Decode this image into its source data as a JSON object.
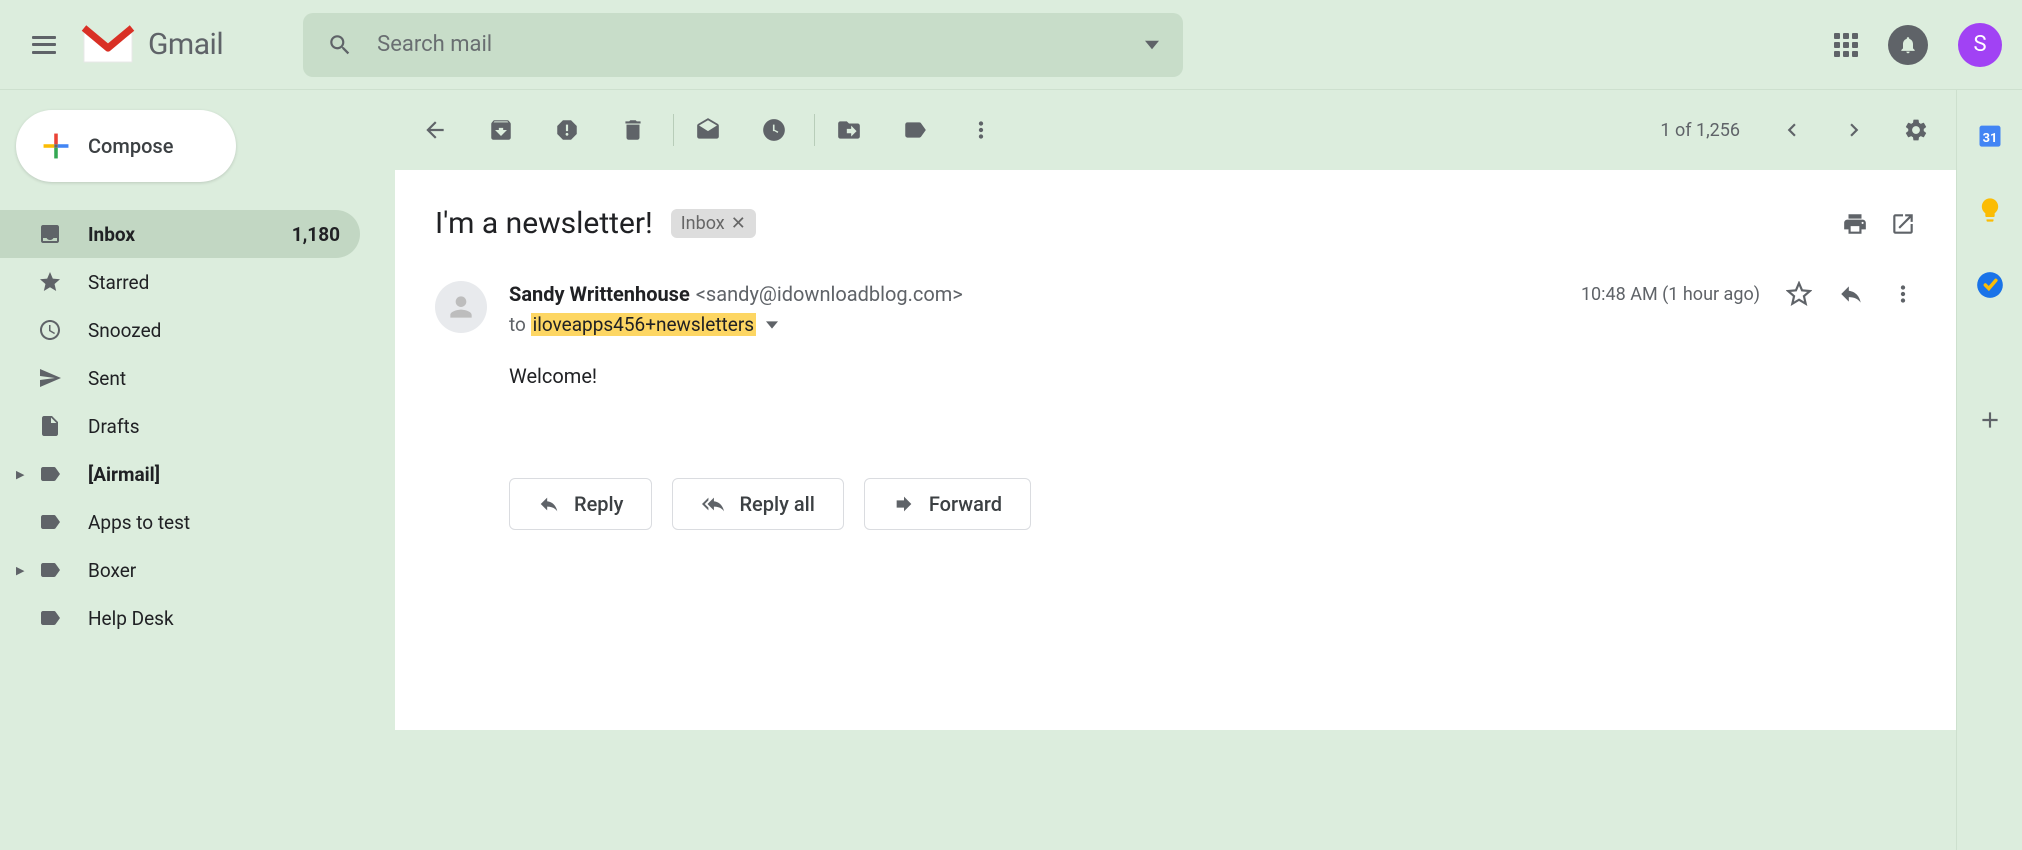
{
  "header": {
    "app_name": "Gmail",
    "search_placeholder": "Search mail",
    "avatar_initial": "S"
  },
  "sidebar": {
    "compose_label": "Compose",
    "folders": [
      {
        "label": "Inbox",
        "count": "1,180"
      },
      {
        "label": "Starred"
      },
      {
        "label": "Snoozed"
      },
      {
        "label": "Sent"
      },
      {
        "label": "Drafts"
      },
      {
        "label": "[Airmail]"
      },
      {
        "label": "Apps to test"
      },
      {
        "label": "Boxer"
      },
      {
        "label": "Help Desk"
      }
    ]
  },
  "toolbar": {
    "pager": "1 of 1,256"
  },
  "message": {
    "subject": "I'm a newsletter!",
    "chip_label": "Inbox",
    "sender_name": "Sandy Writtenhouse",
    "sender_email": "<sandy@idownloadblog.com>",
    "timestamp": "10:48 AM (1 hour ago)",
    "to_prefix": "to",
    "to_address": "iloveapps456+newsletters",
    "body": "Welcome!",
    "actions": {
      "reply": "Reply",
      "reply_all": "Reply all",
      "forward": "Forward"
    }
  }
}
